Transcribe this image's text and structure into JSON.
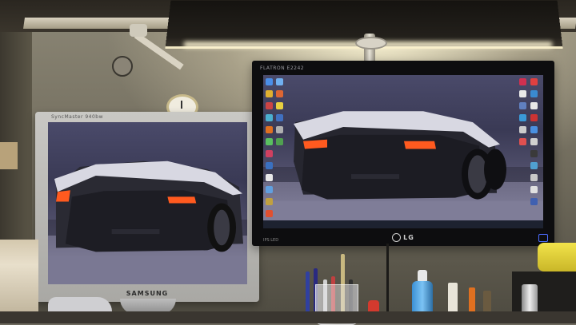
{
  "scene": "two-monitor desk setup",
  "left_monitor": {
    "brand_top": "SyncMaster 940bw",
    "brand_bottom": "SAMSUNG"
  },
  "right_monitor": {
    "brand_top": "FLATRON E2242",
    "brand_bottom": "LG",
    "model_tag": "IPS LED"
  },
  "colors": {
    "sky": "#5b5a7a",
    "car_body": "#d8d8e2",
    "taillight": "#ff5a1f",
    "lamp_glow": "#fff6d4"
  },
  "icons": [
    "car-wallpaper",
    "desktop-icons",
    "lg-logo",
    "power-led"
  ]
}
